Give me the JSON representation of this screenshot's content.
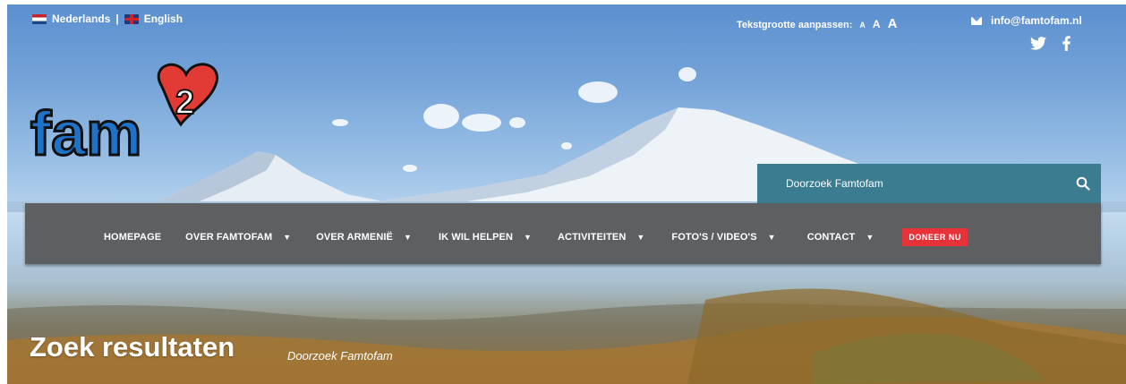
{
  "topbar": {
    "lang_nl": "Nederlands",
    "separator": "|",
    "lang_en": "English",
    "textsize_label": "Tekstgrootte aanpassen:",
    "textsize_small": "A",
    "textsize_medium": "A",
    "textsize_large": "A",
    "email": "info@famtofam.nl"
  },
  "social": {
    "twitter_icon": "twitter-icon",
    "facebook_icon": "facebook-icon"
  },
  "logo": {
    "text": "fam",
    "superscript": "2"
  },
  "search": {
    "placeholder": "Doorzoek Famtofam"
  },
  "nav": {
    "items": [
      {
        "label": "HOMEPAGE",
        "caret": ""
      },
      {
        "label": "OVER FAMTOFAM",
        "caret": "▼"
      },
      {
        "label": "OVER ARMENIË",
        "caret": "▼"
      },
      {
        "label": "IK WIL HELPEN",
        "caret": "▼"
      },
      {
        "label": "ACTIVITEITEN",
        "caret": "▼"
      },
      {
        "label": "FOTO'S / VIDEO'S",
        "caret": "▼"
      },
      {
        "label": "CONTACT",
        "caret": "▼"
      }
    ],
    "donate": "DONEER NU"
  },
  "page": {
    "title": "Zoek resultaten",
    "subtitle": "Doorzoek Famtofam"
  },
  "colors": {
    "nav_bg": "#5e5f61",
    "search_bg": "#3c7c91",
    "donate_bg": "#e8323a",
    "logo_blue": "#1e73c8",
    "logo_heart": "#e23b36"
  }
}
